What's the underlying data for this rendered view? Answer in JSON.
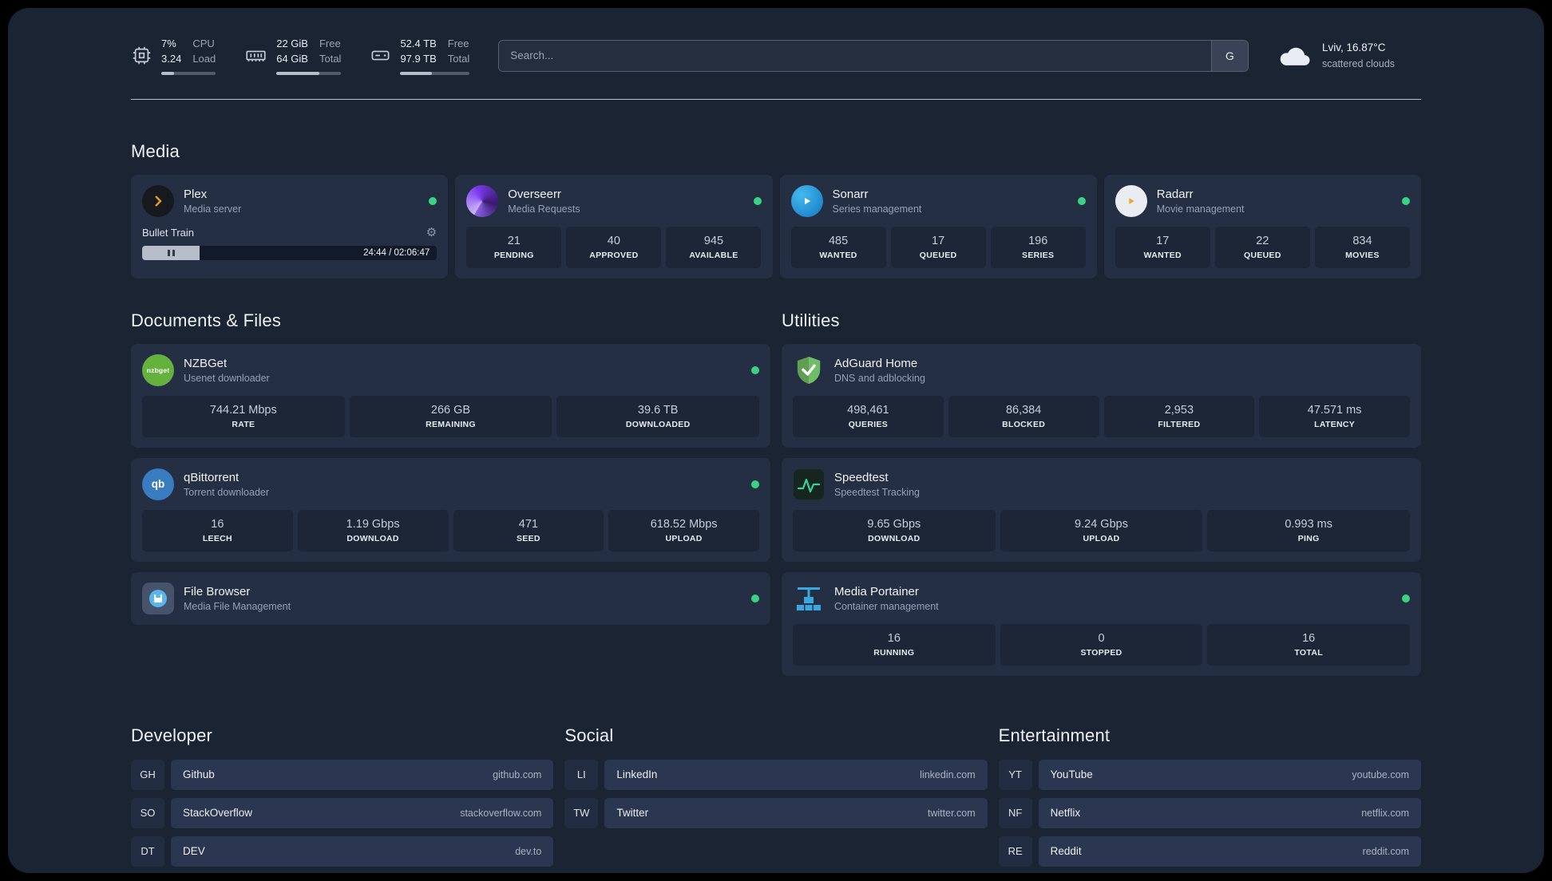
{
  "topbar": {
    "resources": [
      {
        "name": "cpu",
        "values": [
          "7%",
          "3.24"
        ],
        "labels": [
          "CPU",
          "Load"
        ],
        "progress": 24
      },
      {
        "name": "memory",
        "values": [
          "22 GiB",
          "64 GiB"
        ],
        "labels": [
          "Free",
          "Total"
        ],
        "progress": 66
      },
      {
        "name": "disk",
        "values": [
          "52.4 TB",
          "97.9 TB"
        ],
        "labels": [
          "Free",
          "Total"
        ],
        "progress": 46
      }
    ],
    "search": {
      "placeholder": "Search...",
      "provider_label": "G"
    },
    "weather": {
      "location": "Lviv, 16.87°C",
      "condition": "scattered clouds"
    }
  },
  "groups": {
    "media": {
      "title": "Media",
      "services": [
        {
          "name": "Plex",
          "subtitle": "Media server",
          "icon": "plex-icon",
          "status_color": "#3ad385",
          "player": {
            "title": "Bullet Train",
            "time": "24:44 / 02:06:47",
            "progress": 19.6
          }
        },
        {
          "name": "Overseerr",
          "subtitle": "Media Requests",
          "icon": "overseerr-icon",
          "status_color": "#3ad385",
          "stats": [
            {
              "value": "21",
              "label": "PENDING"
            },
            {
              "value": "40",
              "label": "APPROVED"
            },
            {
              "value": "945",
              "label": "AVAILABLE"
            }
          ]
        },
        {
          "name": "Sonarr",
          "subtitle": "Series management",
          "icon": "sonarr-icon",
          "status_color": "#3ad385",
          "stats": [
            {
              "value": "485",
              "label": "WANTED"
            },
            {
              "value": "17",
              "label": "QUEUED"
            },
            {
              "value": "196",
              "label": "SERIES"
            }
          ]
        },
        {
          "name": "Radarr",
          "subtitle": "Movie management",
          "icon": "radarr-icon",
          "status_color": "#3ad385",
          "stats": [
            {
              "value": "17",
              "label": "WANTED"
            },
            {
              "value": "22",
              "label": "QUEUED"
            },
            {
              "value": "834",
              "label": "MOVIES"
            }
          ]
        }
      ]
    },
    "documents": {
      "title": "Documents & Files",
      "services": [
        {
          "name": "NZBGet",
          "subtitle": "Usenet downloader",
          "icon": "nzbget-icon",
          "icon_text": "nzbget",
          "status_color": "#3ad385",
          "stats": [
            {
              "value": "744.21 Mbps",
              "label": "RATE"
            },
            {
              "value": "266 GB",
              "label": "REMAINING"
            },
            {
              "value": "39.6 TB",
              "label": "DOWNLOADED"
            }
          ]
        },
        {
          "name": "qBittorrent",
          "subtitle": "Torrent downloader",
          "icon": "qbittorrent-icon",
          "icon_text": "qb",
          "status_color": "#3ad385",
          "stats": [
            {
              "value": "16",
              "label": "LEECH"
            },
            {
              "value": "1.19 Gbps",
              "label": "DOWNLOAD"
            },
            {
              "value": "471",
              "label": "SEED"
            },
            {
              "value": "618.52 Mbps",
              "label": "UPLOAD"
            }
          ]
        },
        {
          "name": "File Browser",
          "subtitle": "Media File Management",
          "icon": "filebrowser-icon",
          "status_color": "#3ad385"
        }
      ]
    },
    "utilities": {
      "title": "Utilities",
      "services": [
        {
          "name": "AdGuard Home",
          "subtitle": "DNS and adblocking",
          "icon": "adguard-icon",
          "stats": [
            {
              "value": "498,461",
              "label": "QUERIES"
            },
            {
              "value": "86,384",
              "label": "BLOCKED"
            },
            {
              "value": "2,953",
              "label": "FILTERED"
            },
            {
              "value": "47.571 ms",
              "label": "LATENCY"
            }
          ]
        },
        {
          "name": "Speedtest",
          "subtitle": "Speedtest Tracking",
          "icon": "speedtest-icon",
          "stats": [
            {
              "value": "9.65 Gbps",
              "label": "DOWNLOAD"
            },
            {
              "value": "9.24 Gbps",
              "label": "UPLOAD"
            },
            {
              "value": "0.993 ms",
              "label": "PING"
            }
          ]
        },
        {
          "name": "Media Portainer",
          "subtitle": "Container management",
          "icon": "portainer-icon",
          "status_color": "#3ad385",
          "stats": [
            {
              "value": "16",
              "label": "RUNNING"
            },
            {
              "value": "0",
              "label": "STOPPED"
            },
            {
              "value": "16",
              "label": "TOTAL"
            }
          ]
        }
      ]
    }
  },
  "bookmarks": [
    {
      "title": "Developer",
      "items": [
        {
          "abbr": "GH",
          "name": "Github",
          "url": "github.com"
        },
        {
          "abbr": "SO",
          "name": "StackOverflow",
          "url": "stackoverflow.com"
        },
        {
          "abbr": "DT",
          "name": "DEV",
          "url": "dev.to"
        }
      ]
    },
    {
      "title": "Social",
      "items": [
        {
          "abbr": "LI",
          "name": "LinkedIn",
          "url": "linkedin.com"
        },
        {
          "abbr": "TW",
          "name": "Twitter",
          "url": "twitter.com"
        }
      ]
    },
    {
      "title": "Entertainment",
      "items": [
        {
          "abbr": "YT",
          "name": "YouTube",
          "url": "youtube.com"
        },
        {
          "abbr": "NF",
          "name": "Netflix",
          "url": "netflix.com"
        },
        {
          "abbr": "RE",
          "name": "Reddit",
          "url": "reddit.com"
        }
      ]
    }
  ]
}
